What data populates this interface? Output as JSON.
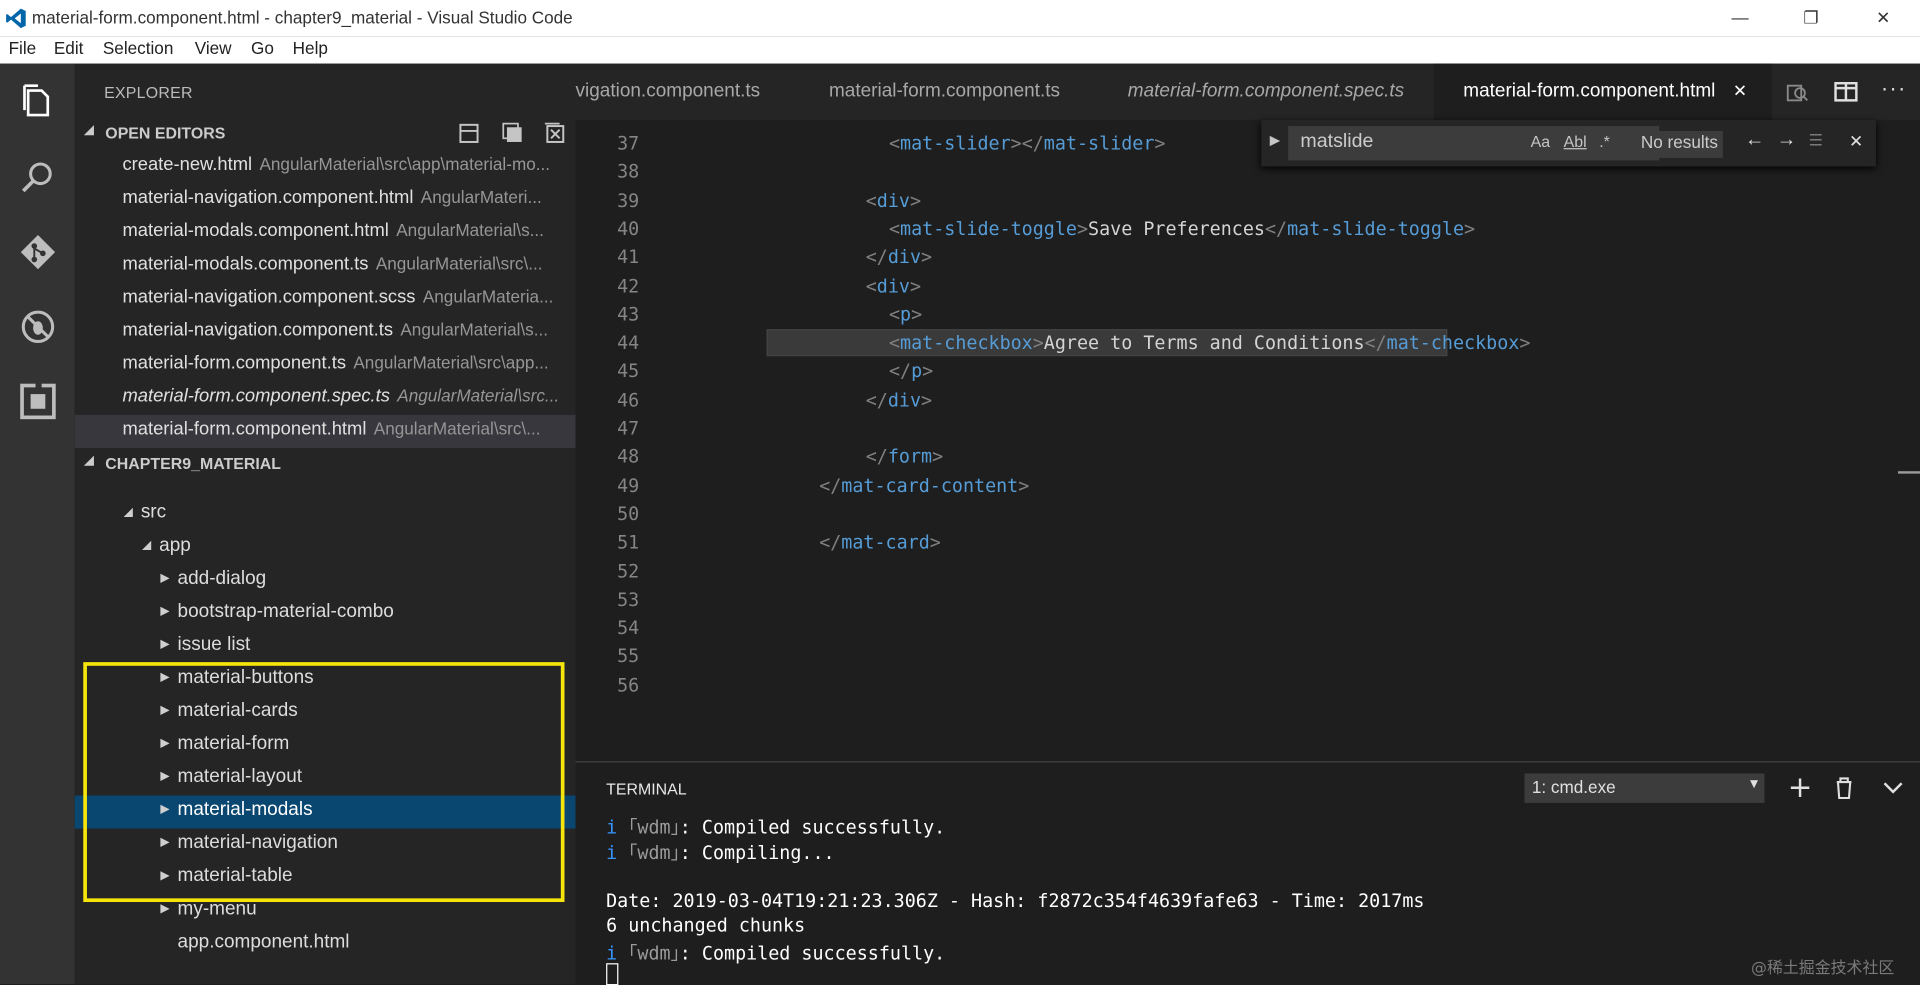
{
  "window": {
    "title": "material-form.component.html - chapter9_material - Visual Studio Code",
    "buttons": {
      "minimize": "—",
      "restore": "❐",
      "close": "✕"
    }
  },
  "menu": [
    "File",
    "Edit",
    "Selection",
    "View",
    "Go",
    "Help"
  ],
  "activity": [
    "explorer-icon",
    "search-icon",
    "source-control-icon",
    "debug-icon",
    "extensions-icon"
  ],
  "sidebar": {
    "title": "EXPLORER",
    "open_editors": {
      "label": "OPEN EDITORS",
      "items": [
        {
          "name": "create-new.html",
          "path": "AngularMaterial\\src\\app\\material-mo..."
        },
        {
          "name": "material-navigation.component.html",
          "path": "AngularMateri..."
        },
        {
          "name": "material-modals.component.html",
          "path": "AngularMaterial\\s..."
        },
        {
          "name": "material-modals.component.ts",
          "path": "AngularMaterial\\src\\..."
        },
        {
          "name": "material-navigation.component.scss",
          "path": "AngularMateria..."
        },
        {
          "name": "material-navigation.component.ts",
          "path": "AngularMaterial\\s..."
        },
        {
          "name": "material-form.component.ts",
          "path": "AngularMaterial\\src\\app..."
        },
        {
          "name": "material-form.component.spec.ts",
          "path": "AngularMaterial\\src..."
        },
        {
          "name": "material-form.component.html",
          "path": "AngularMaterial\\src\\..."
        }
      ]
    },
    "project": {
      "label": "CHAPTER9_MATERIAL",
      "tree": [
        {
          "name": "src",
          "twisty": "◢"
        },
        {
          "name": "app",
          "twisty": "◢"
        },
        {
          "name": "add-dialog",
          "twisty": "▶"
        },
        {
          "name": "bootstrap-material-combo",
          "twisty": "▶"
        },
        {
          "name": "issue list",
          "twisty": "▶"
        },
        {
          "name": "material-buttons",
          "twisty": "▶"
        },
        {
          "name": "material-cards",
          "twisty": "▶"
        },
        {
          "name": "material-form",
          "twisty": "▶"
        },
        {
          "name": "material-layout",
          "twisty": "▶"
        },
        {
          "name": "material-modals",
          "twisty": "▶"
        },
        {
          "name": "material-navigation",
          "twisty": "▶"
        },
        {
          "name": "material-table",
          "twisty": "▶"
        },
        {
          "name": "my-menu",
          "twisty": "▶"
        },
        {
          "name": "app.component.html",
          "twisty": ""
        }
      ]
    }
  },
  "tabs": [
    {
      "label": "vigation.component.ts"
    },
    {
      "label": "material-form.component.ts"
    },
    {
      "label": "material-form.component.spec.ts"
    },
    {
      "label": "material-form.component.html",
      "close": "✕"
    }
  ],
  "editor": {
    "line_numbers": [
      "37",
      "38",
      "39",
      "40",
      "41",
      "42",
      "43",
      "44",
      "45",
      "46",
      "47",
      "48",
      "49",
      "50",
      "51",
      "52",
      "53",
      "54",
      "55",
      "56"
    ],
    "lines": [
      {
        "indent": 8,
        "parts": [
          [
            "t",
            "<"
          ],
          [
            "n",
            "mat-slider"
          ],
          [
            "t",
            "></"
          ],
          [
            "n",
            "mat-slider"
          ],
          [
            "t",
            ">"
          ]
        ]
      },
      {
        "indent": 0,
        "parts": []
      },
      {
        "indent": 7,
        "parts": [
          [
            "t",
            "<"
          ],
          [
            "n",
            "div"
          ],
          [
            "t",
            ">"
          ]
        ]
      },
      {
        "indent": 8,
        "parts": [
          [
            "t",
            "<"
          ],
          [
            "n",
            "mat-slide-toggle"
          ],
          [
            "t",
            ">"
          ],
          [
            "x",
            "Save Preferences"
          ],
          [
            "t",
            "</"
          ],
          [
            "n",
            "mat-slide-toggle"
          ],
          [
            "t",
            ">"
          ]
        ]
      },
      {
        "indent": 7,
        "parts": [
          [
            "t",
            "</"
          ],
          [
            "n",
            "div"
          ],
          [
            "t",
            ">"
          ]
        ]
      },
      {
        "indent": 7,
        "parts": [
          [
            "t",
            "<"
          ],
          [
            "n",
            "div"
          ],
          [
            "t",
            ">"
          ]
        ]
      },
      {
        "indent": 8,
        "parts": [
          [
            "t",
            "<"
          ],
          [
            "n",
            "p"
          ],
          [
            "t",
            ">"
          ]
        ]
      },
      {
        "indent": 8,
        "parts": [
          [
            "t",
            "<"
          ],
          [
            "n",
            "mat-checkbox"
          ],
          [
            "t",
            ">"
          ],
          [
            "x",
            "Agree to Terms and Conditions"
          ],
          [
            "t",
            "</"
          ],
          [
            "n",
            "mat-checkbox"
          ],
          [
            "t",
            ">"
          ]
        ]
      },
      {
        "indent": 8,
        "parts": [
          [
            "t",
            "</"
          ],
          [
            "n",
            "p"
          ],
          [
            "t",
            ">"
          ]
        ]
      },
      {
        "indent": 7,
        "parts": [
          [
            "t",
            "</"
          ],
          [
            "n",
            "div"
          ],
          [
            "t",
            ">"
          ]
        ]
      },
      {
        "indent": 0,
        "parts": []
      },
      {
        "indent": 7,
        "parts": [
          [
            "t",
            "</"
          ],
          [
            "n",
            "form"
          ],
          [
            "t",
            ">"
          ]
        ]
      },
      {
        "indent": 5,
        "parts": [
          [
            "t",
            "</"
          ],
          [
            "n",
            "mat-card-content"
          ],
          [
            "t",
            ">"
          ]
        ]
      },
      {
        "indent": 0,
        "parts": []
      },
      {
        "indent": 5,
        "parts": [
          [
            "t",
            "</"
          ],
          [
            "n",
            "mat-card"
          ],
          [
            "t",
            ">"
          ]
        ]
      },
      {
        "indent": 0,
        "parts": []
      },
      {
        "indent": 0,
        "parts": []
      },
      {
        "indent": 0,
        "parts": []
      },
      {
        "indent": 0,
        "parts": []
      },
      {
        "indent": 0,
        "parts": []
      }
    ]
  },
  "find": {
    "value": "matslide",
    "match_case": "Aa",
    "whole_word": "Abl",
    "regex": ".*",
    "result": "No results"
  },
  "terminal": {
    "title": "TERMINAL",
    "selected": "1: cmd.exe",
    "lines": [
      {
        "info": "i",
        "wdm": "｢wdm｣",
        "text": ": Compiled successfully."
      },
      {
        "info": "i",
        "wdm": "｢wdm｣",
        "text": ": Compiling..."
      },
      {
        "info": "",
        "wdm": "",
        "text": ""
      },
      {
        "info": "",
        "wdm": "",
        "text": "Date: 2019-03-04T19:21:23.306Z - Hash: f2872c354f4639fafe63 - Time: 2017ms"
      },
      {
        "info": "",
        "wdm": "",
        "text": "6 unchanged chunks"
      },
      {
        "info": "i",
        "wdm": "｢wdm｣",
        "text": ": Compiled successfully."
      }
    ]
  },
  "watermark": "@稀土掘金技术社区"
}
